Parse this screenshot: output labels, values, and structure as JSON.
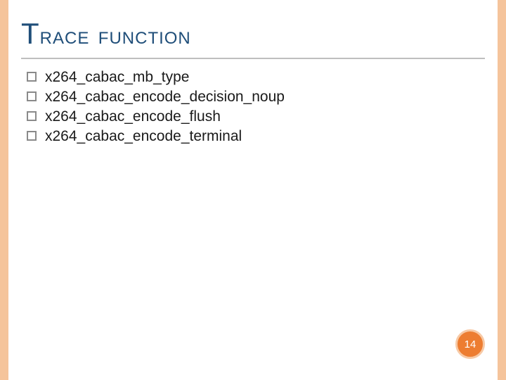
{
  "title": {
    "first": "T",
    "rest": "race function"
  },
  "bullets": [
    "x264_cabac_mb_type",
    "x264_cabac_encode_decision_noup",
    "x264_cabac_encode_flush",
    "x264_cabac_encode_terminal"
  ],
  "page_number": "14"
}
